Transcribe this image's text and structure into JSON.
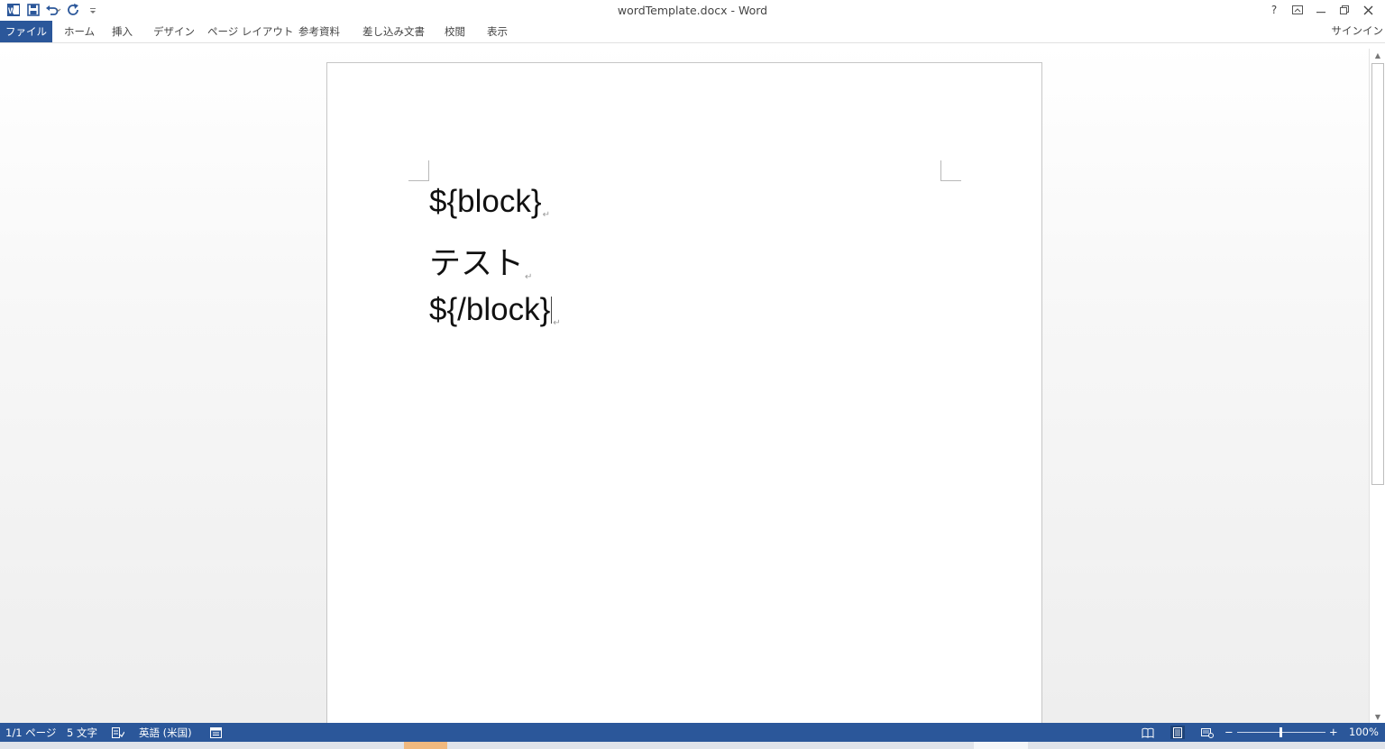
{
  "window": {
    "title": "wordTemplate.docx - Word",
    "controls": {
      "help": "?",
      "ribbon_display": "⧉",
      "minimize": "—",
      "restore": "🗗",
      "close": "✕"
    }
  },
  "quick_access": {
    "app_icon": "word-logo-icon",
    "save_icon": "save-icon",
    "undo_icon": "undo-icon",
    "redo_icon": "redo-icon",
    "customize_icon": "customize-qat-icon"
  },
  "ribbon": {
    "tabs": [
      {
        "label": "ファイル"
      },
      {
        "label": "ホーム"
      },
      {
        "label": "挿入"
      },
      {
        "label": "デザイン"
      },
      {
        "label": "ページ レイアウト"
      },
      {
        "label": "参考資料"
      },
      {
        "label": "差し込み文書"
      },
      {
        "label": "校閲"
      },
      {
        "label": "表示"
      }
    ],
    "signin": "サインイン"
  },
  "document": {
    "paragraphs": [
      {
        "text": "${block}"
      },
      {
        "text": "テスト"
      },
      {
        "text": "${/block}"
      }
    ],
    "paragraph_mark": "↵"
  },
  "status_bar": {
    "page": "1/1 ページ",
    "word_count": "5 文字",
    "language": "英語 (米国)",
    "zoom_minus": "−",
    "zoom_plus": "+",
    "zoom_level": "100%",
    "zoom_fraction": 0.5
  },
  "colors": {
    "accent": "#2b579a"
  }
}
